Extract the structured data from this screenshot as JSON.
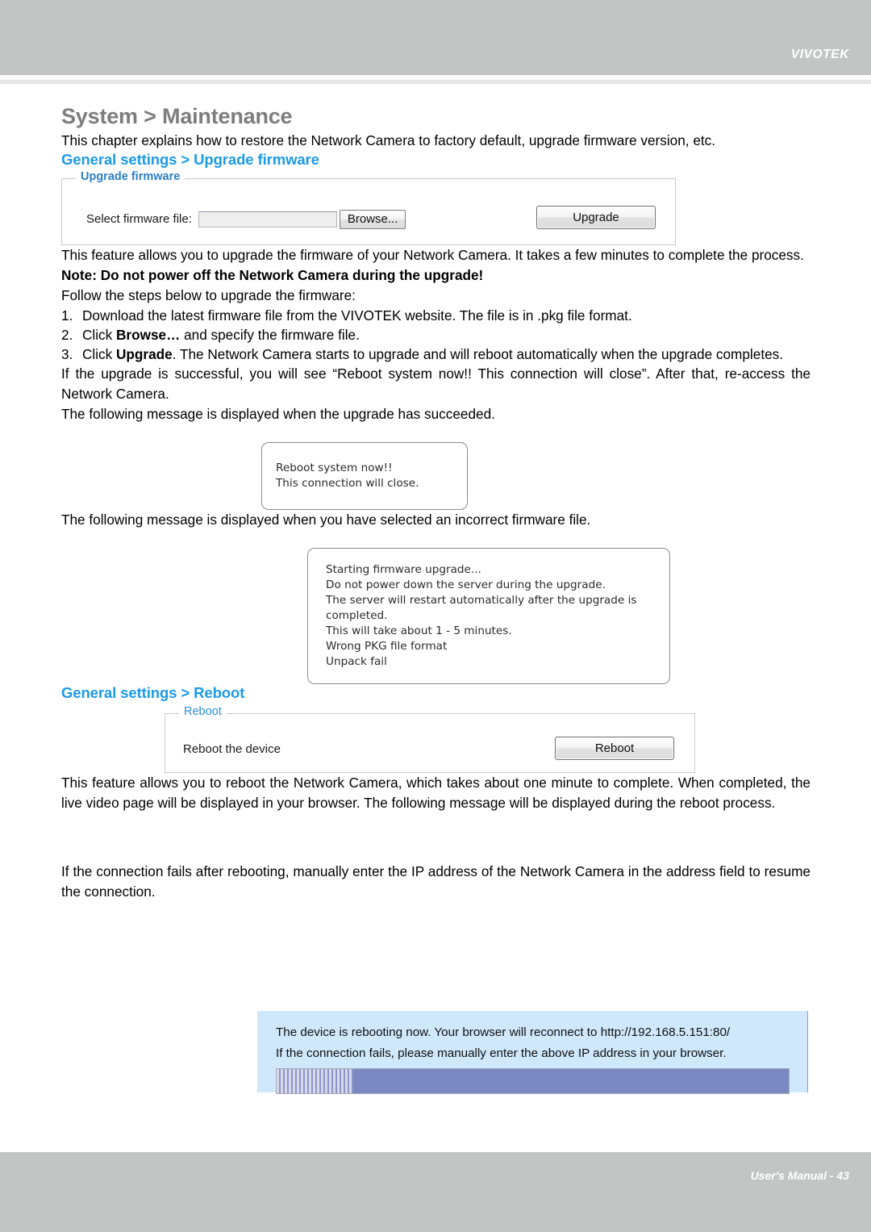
{
  "header": {
    "brand": "VIVOTEK"
  },
  "page": {
    "title": "System > Maintenance",
    "intro": "This chapter explains how to restore the Network Camera to factory default, upgrade firmware version, etc."
  },
  "upgrade_section": {
    "heading": "General settings > Upgrade firmware",
    "panel": {
      "legend": "Upgrade firmware",
      "file_label": "Select firmware file:",
      "file_value": "",
      "file_placeholder": "",
      "browse_label": "Browse...",
      "upgrade_label": "Upgrade"
    },
    "paragraph": "This feature allows you to upgrade the firmware of your Network Camera. It takes a few minutes to complete the process.",
    "note": "Note: Do not power off the Network Camera during the upgrade!",
    "steps_intro": "Follow the steps below to upgrade the firmware:",
    "steps": [
      {
        "num": "1.",
        "text_before": "Download the latest firmware file from the VIVOTEK website. The file is in .pkg file format.",
        "bold": "",
        "text_after": ""
      },
      {
        "num": "2.",
        "text_before": "Click ",
        "bold": "Browse…",
        "text_after": " and specify the firmware file."
      },
      {
        "num": "3.",
        "text_before": "Click ",
        "bold": "Upgrade",
        "text_after": ". The Network Camera starts to upgrade and will reboot automatically when the upgrade completes."
      }
    ],
    "success_paragraph": "If the upgrade is successful, you will see “Reboot system now!! This connection will close”. After that, re-access the Network Camera.",
    "success_caption": "The following message is displayed when the upgrade has succeeded.",
    "success_dialog": {
      "lines": [
        "Reboot system now!!",
        "This connection will close."
      ]
    },
    "error_caption": "The following message is displayed when you have selected an incorrect firmware file.",
    "error_dialog": {
      "lines": [
        "Starting firmware upgrade...",
        "Do not power down the server during the upgrade.",
        "The server will restart automatically after the upgrade is",
        "completed.",
        "This will take about 1 - 5 minutes.",
        "Wrong PKG file format",
        "Unpack fail"
      ]
    }
  },
  "reboot_section": {
    "heading": "General settings > Reboot",
    "panel": {
      "legend": "Reboot",
      "device_label": "Reboot the device",
      "reboot_label": "Reboot"
    },
    "paragraph": "This feature allows you to reboot the Network Camera, which takes about one minute to complete. When completed, the live video page will be displayed in your browser. The following message will be displayed during the reboot process.",
    "dialog": {
      "line1": "The device is rebooting now. Your browser will reconnect to http://192.168.5.151:80/",
      "line2": "If the connection fails, please manually enter the above IP address in your browser.",
      "progress_percent": 15
    },
    "closing_paragraph": "If the connection fails after rebooting, manually enter the IP address of the Network Camera in the address field to resume the connection."
  },
  "footer": {
    "text": "User's Manual - 43"
  },
  "colors": {
    "header_band": "#c3c4c4",
    "section_heading": "#1b9ae8",
    "page_title": "#7d7d7d",
    "dialog_background": "#cfe8fb",
    "progress_bar": "#7b88c2"
  }
}
